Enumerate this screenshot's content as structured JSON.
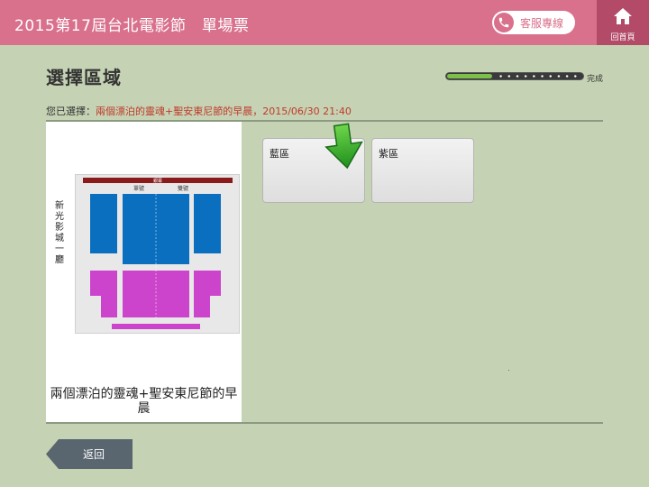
{
  "header": {
    "title": "2015第17屆台北電影節　單場票",
    "hotline_label": "客服專線",
    "home_label": "回首頁",
    "brand_color": "#d9708c"
  },
  "page": {
    "title": "選擇區域",
    "progress_label": "完成",
    "progress_fraction": 0.33
  },
  "selection": {
    "prefix": "您已選擇：",
    "value": "兩個漂泊的靈魂+聖安東尼節的早晨，2015/06/30 21:40"
  },
  "left_panel": {
    "seatmap": {
      "screen_label": "銀幕",
      "left_aisle_label": "單號",
      "right_aisle_label": "雙號"
    },
    "cinema_name": "新光影城 一廳",
    "movie_title": "兩個漂泊的靈魂+聖安東尼節的早晨"
  },
  "zones": [
    {
      "label": "藍區",
      "color": "#0b6fbf"
    },
    {
      "label": "紫區",
      "color": "#cc44cc"
    }
  ],
  "footer": {
    "back_label": "返回"
  },
  "icons": {
    "hotline": "phone-icon",
    "home": "home-icon",
    "hint": "arrow-down-icon"
  }
}
